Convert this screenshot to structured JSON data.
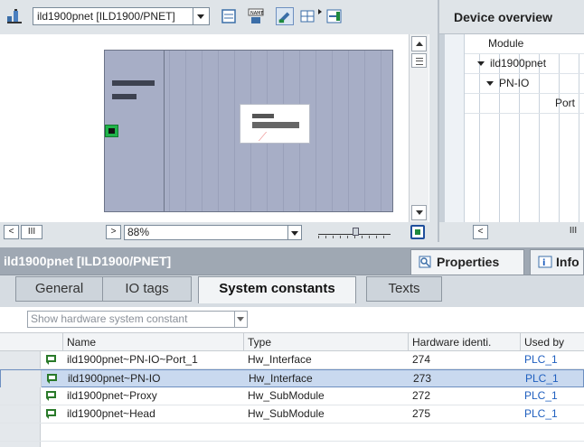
{
  "toolbar": {
    "device_select_value": "ild1900pnet [ILD1900/PNET]",
    "icons": [
      "network-view-icon",
      "device-dropdown-icon",
      "device-overview-icon",
      "name-icon",
      "show-tags-icon",
      "grid-icon",
      "more-icon",
      "overview-toggle-icon"
    ]
  },
  "canvas": {
    "zoom_value": "88%",
    "scroll_left": "<",
    "scroll_pos": "III",
    "scroll_right": ">"
  },
  "overview": {
    "title": "Device overview",
    "column_module": "Module",
    "rows": [
      "ild1900pnet",
      "PN-IO",
      "Port"
    ],
    "scroll_left": "<",
    "scroll_pos": "III"
  },
  "properties": {
    "object_title": "ild1900pnet [ILD1900/PNET]",
    "tab_properties": "Properties",
    "tab_info": "Info",
    "subtabs": [
      "General",
      "IO tags",
      "System constants",
      "Texts"
    ],
    "active_subtab": "System constants",
    "filter_value": "Show hardware system constant",
    "columns": [
      "Name",
      "Type",
      "Hardware identi.",
      "Used by"
    ],
    "rows": [
      {
        "name": "ild1900pnet~PN-IO~Port_1",
        "type": "Hw_Interface",
        "hwid": "274",
        "used_by": "PLC_1"
      },
      {
        "name": "ild1900pnet~PN-IO",
        "type": "Hw_Interface",
        "hwid": "273",
        "used_by": "PLC_1"
      },
      {
        "name": "ild1900pnet~Proxy",
        "type": "Hw_SubModule",
        "hwid": "272",
        "used_by": "PLC_1"
      },
      {
        "name": "ild1900pnet~Head",
        "type": "Hw_SubModule",
        "hwid": "275",
        "used_by": "PLC_1"
      }
    ],
    "selected_row": 1
  },
  "colors": {
    "port_green": "#1fb34a",
    "canvas_bg": "#a7aec6",
    "header_bar": "#9fa8b3",
    "selection": "#c9d9ef",
    "link": "#1f5fbf"
  }
}
